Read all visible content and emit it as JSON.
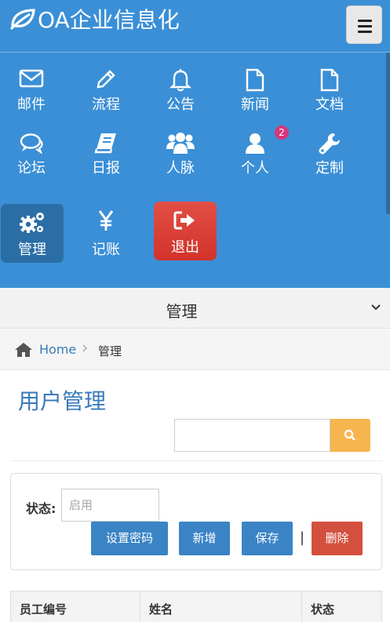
{
  "header": {
    "app_title": "OA企业信息化",
    "logo_icon": "leaf-icon",
    "menu_icon": "hamburger-icon"
  },
  "nav": {
    "items": [
      {
        "label": "邮件",
        "icon": "envelope-icon"
      },
      {
        "label": "流程",
        "icon": "pencil-icon"
      },
      {
        "label": "公告",
        "icon": "bell-icon"
      },
      {
        "label": "新闻",
        "icon": "file-icon"
      },
      {
        "label": "文档",
        "icon": "file-icon"
      },
      {
        "label": "论坛",
        "icon": "comments-icon"
      },
      {
        "label": "日报",
        "icon": "book-icon"
      },
      {
        "label": "人脉",
        "icon": "users-icon"
      },
      {
        "label": "个人",
        "icon": "user-icon",
        "badge": "2"
      },
      {
        "label": "定制",
        "icon": "wrench-icon"
      },
      {
        "label": "管理",
        "icon": "gears-icon",
        "active": true
      },
      {
        "label": "记账",
        "icon": "yen-icon"
      },
      {
        "label": "退出",
        "icon": "sign-out-icon"
      }
    ]
  },
  "section": {
    "title": "管理",
    "toggle_icon": "chevron-down-icon"
  },
  "breadcrumb": {
    "home": "Home",
    "current": "管理"
  },
  "page": {
    "title": "用户管理",
    "search_placeholder": "",
    "search_icon": "search-icon"
  },
  "filter": {
    "status_label": "状态:",
    "status_placeholder": "启用"
  },
  "actions": {
    "set_password": "设置密码",
    "add": "新增",
    "save": "保存",
    "separator": "|",
    "delete": "删除"
  },
  "table": {
    "columns": [
      "员工编号",
      "姓名",
      "状态"
    ]
  },
  "colors": {
    "header_bg": "#3a8fd6",
    "active_nav_bg": "#2b6ea6",
    "logout_bg": "#d2332b",
    "badge": "#d7367c",
    "primary_button": "#3a84c6",
    "danger_button": "#d4503e",
    "search_button": "#f6b54e"
  }
}
